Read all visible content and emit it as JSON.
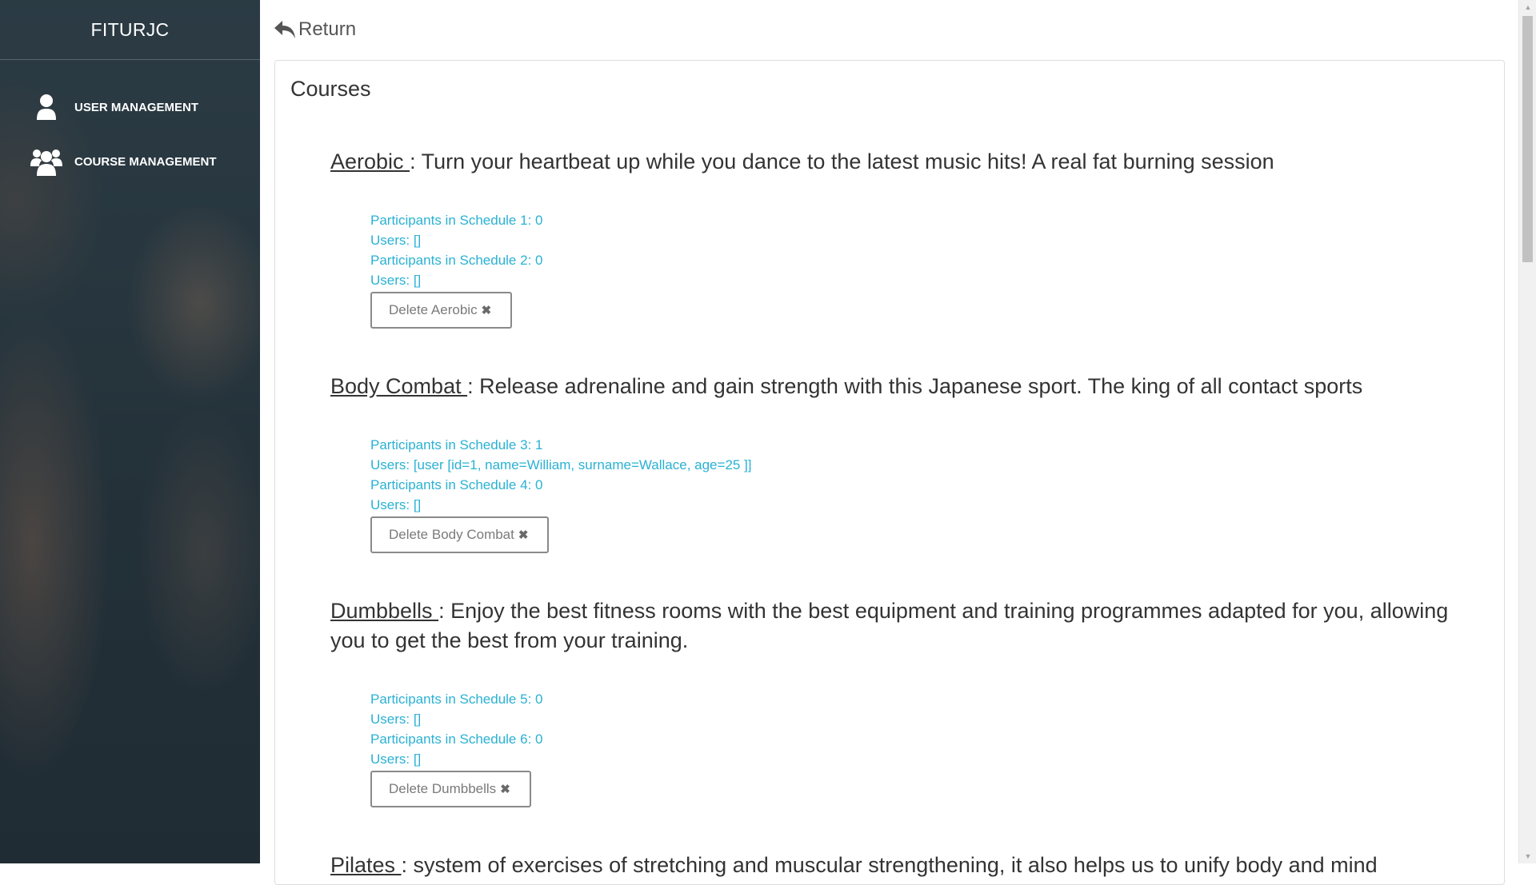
{
  "sidebar": {
    "brand": "FITURJC",
    "items": [
      {
        "label": "USER MANAGEMENT",
        "icon": "user-icon"
      },
      {
        "label": "COURSE MANAGEMENT",
        "icon": "users-group-icon"
      }
    ]
  },
  "topbar": {
    "return_label": "Return",
    "return_icon": "reply-arrow-icon"
  },
  "main": {
    "title": "Courses",
    "courses": [
      {
        "name": "Aerobic ",
        "description": ": Turn your heartbeat up while you dance to the latest music hits! A real fat burning session",
        "details": [
          "Participants in Schedule 1: 0",
          "Users: []",
          "Participants in Schedule 2: 0",
          "Users: []"
        ],
        "delete_label": "Delete Aerobic"
      },
      {
        "name": "Body Combat ",
        "description": ": Release adrenaline and gain strength with this Japanese sport. The king of all contact sports",
        "details": [
          "Participants in Schedule 3: 1",
          "Users: [user [id=1, name=William, surname=Wallace, age=25 ]]",
          "Participants in Schedule 4: 0",
          "Users: []"
        ],
        "delete_label": "Delete Body Combat"
      },
      {
        "name": "Dumbbells ",
        "description": ": Enjoy the best fitness rooms with the best equipment and training programmes adapted for you, allowing you to get the best from your training.",
        "details": [
          "Participants in Schedule 5: 0",
          "Users: []",
          "Participants in Schedule 6: 0",
          "Users: []"
        ],
        "delete_label": "Delete Dumbbells"
      },
      {
        "name": "Pilates ",
        "description": ": system of exercises of stretching and muscular strengthening, it also helps us to unify body and mind"
      }
    ]
  },
  "colors": {
    "detail_text": "#2ab1d4",
    "sidebar_bg": "#2e3d47",
    "button_border": "#8a8a8a"
  }
}
